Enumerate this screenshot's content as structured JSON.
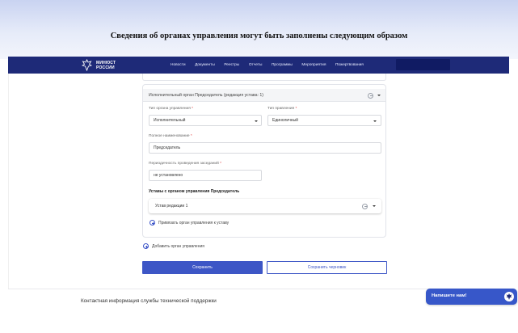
{
  "page": {
    "heading": "Сведения об органах управления могут быть заполнены следующим образом"
  },
  "header": {
    "logo_line1": "МИНЮСТ",
    "logo_line2": "РОССИИ",
    "nav": [
      "Новости",
      "Документы",
      "Реестры",
      "Отчеты",
      "Программы",
      "Мероприятия",
      "Пожертвования"
    ]
  },
  "section": {
    "title": "Исполнительный орган Председатель (редакция устава: 1)",
    "body_type": {
      "label": "Тип органа управления",
      "value": "Исполнительный"
    },
    "gov_type": {
      "label": "Тип правления",
      "value": "Единоличный"
    },
    "full_name": {
      "label": "Полное наименование",
      "value": "Председатель"
    },
    "periodicity": {
      "label": "Периодичность проведения заседаний",
      "value": "не установлено"
    },
    "charters_title": "Уставы с органом управления Председатель",
    "charter_item": "Устав редакции 1",
    "attach_link": "Привязать орган управления к уставу"
  },
  "add_body_link": "Добавить орган управления",
  "buttons": {
    "save": "Сохранить",
    "draft": "Сохранить черновик"
  },
  "footer": {
    "contact": "Контактная информация службы технической поддержки"
  },
  "chat": {
    "label": "Напишите нам!"
  },
  "colors": {
    "navbar": "#1e2a78",
    "accent": "#3d56c6",
    "required": "#dd3333"
  }
}
